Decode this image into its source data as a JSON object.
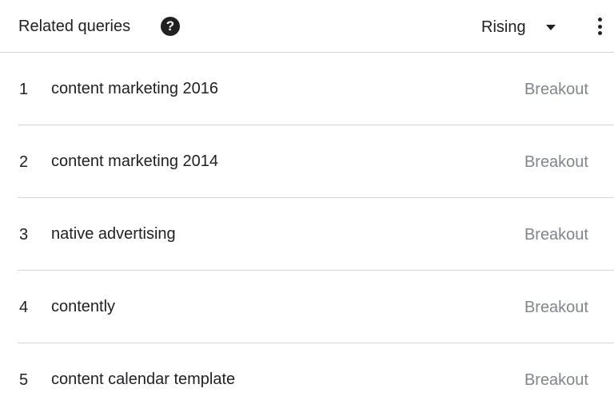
{
  "header": {
    "title": "Related queries",
    "help_icon": "help-circle-icon",
    "help_glyph": "?",
    "dropdown_label": "Rising",
    "dropdown_icon": "caret-down-icon",
    "menu_icon": "more-vert-icon"
  },
  "rows": [
    {
      "rank": "1",
      "query": "content marketing 2016",
      "value": "Breakout"
    },
    {
      "rank": "2",
      "query": "content marketing 2014",
      "value": "Breakout"
    },
    {
      "rank": "3",
      "query": "native advertising",
      "value": "Breakout"
    },
    {
      "rank": "4",
      "query": "contently",
      "value": "Breakout"
    },
    {
      "rank": "5",
      "query": "content calendar template",
      "value": "Breakout"
    }
  ],
  "colors": {
    "text": "#202124",
    "muted": "#80868b",
    "divider": "#d5d5d5"
  }
}
